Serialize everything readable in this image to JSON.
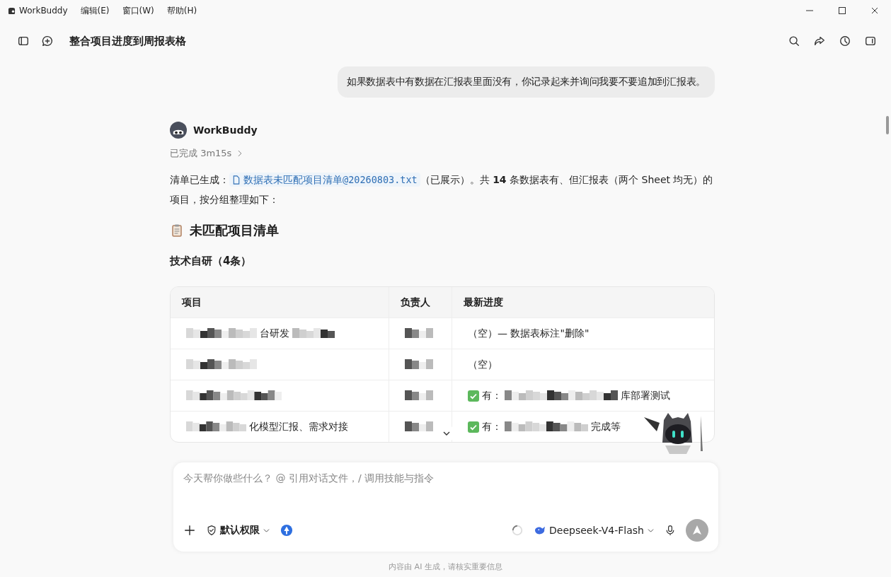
{
  "app": {
    "name": "WorkBuddy",
    "menu": [
      "编辑(E)",
      "窗口(W)",
      "帮助(H)"
    ]
  },
  "header": {
    "title": "整合项目进度到周报表格"
  },
  "user_message": "如果数据表中有数据在汇报表里面没有，你记录起来并询问我要不要追加到汇报表。",
  "assistant": {
    "name": "WorkBuddy",
    "status": "已完成 3m15s",
    "intro_before": "清单已生成：",
    "file": "数据表未匹配项目清单@20260803.txt",
    "intro_after": "（已展示）。共 **14** 条数据表有、但汇报表（两个 Sheet 均无）的项目，按分组整理如下：",
    "heading": "未匹配项目清单",
    "subheading": "技术自研（4条）",
    "table": {
      "columns": [
        "项目",
        "负责人",
        "最新进度"
      ],
      "rows": [
        {
          "cells": [
            [
              {
                "kind": "mosaic"
              },
              {
                "kind": "text",
                "text": "台研发"
              },
              {
                "kind": "mosaic"
              }
            ],
            [
              {
                "kind": "mosaic"
              }
            ],
            [
              {
                "kind": "text",
                "text": "（空）— 数据表标注\"删除\""
              }
            ]
          ]
        },
        {
          "cells": [
            [
              {
                "kind": "mosaic"
              }
            ],
            [
              {
                "kind": "mosaic"
              }
            ],
            [
              {
                "kind": "text",
                "text": "（空）"
              }
            ]
          ]
        },
        {
          "cells": [
            [
              {
                "kind": "mosaic"
              }
            ],
            [
              {
                "kind": "mosaic"
              }
            ],
            [
              {
                "kind": "check"
              },
              {
                "kind": "text",
                "text": "有："
              },
              {
                "kind": "mosaic"
              },
              {
                "kind": "text",
                "text": "库部署测试"
              }
            ]
          ]
        },
        {
          "cells": [
            [
              {
                "kind": "mosaic"
              },
              {
                "kind": "text",
                "text": "化模型汇报、需求对接"
              }
            ],
            [
              {
                "kind": "mosaic"
              }
            ],
            [
              {
                "kind": "check"
              },
              {
                "kind": "text",
                "text": "有："
              },
              {
                "kind": "mosaic"
              },
              {
                "kind": "text",
                "text": "完成等"
              }
            ]
          ]
        }
      ]
    }
  },
  "composer": {
    "placeholder": "今天帮你做些什么？ @ 引用对话文件，/ 调用技能与指令",
    "permission": "默认权限",
    "model": "Deepseek-V4-Flash"
  },
  "footer_note": "内容由 AI 生成，请核实重要信息"
}
